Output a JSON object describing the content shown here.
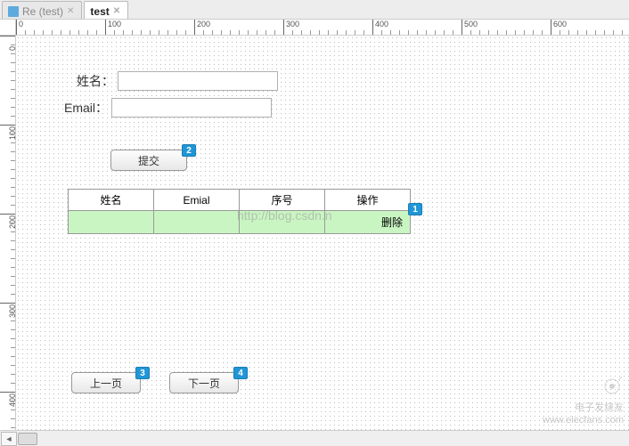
{
  "tabs": [
    {
      "label": "Re (test)",
      "active": false,
      "has_icon": true
    },
    {
      "label": "test",
      "active": true,
      "has_icon": false
    }
  ],
  "ruler_ticks": [
    0,
    100,
    200,
    300,
    400,
    500,
    600
  ],
  "ruler_ticks_v": [
    0,
    100,
    200,
    300,
    400
  ],
  "form": {
    "name_label": "姓名：",
    "email_label": "Email：",
    "name_value": "",
    "email_value": ""
  },
  "buttons": {
    "submit": "提交",
    "prev": "上一页",
    "next": "下一页"
  },
  "table": {
    "headers": [
      "姓名",
      "Emial",
      "序号",
      "操作"
    ],
    "row": {
      "name": "",
      "email": "",
      "seq": "",
      "action": "删除"
    }
  },
  "badges": {
    "b1": "1",
    "b2": "2",
    "b3": "3",
    "b4": "4"
  },
  "watermark_center": "http://blog.csdn.n",
  "watermark_source_line1": "电子发烧友",
  "watermark_source_line2": "www.elecfans.com",
  "chart_data": {
    "type": "table",
    "headers": [
      "姓名",
      "Emial",
      "序号",
      "操作"
    ],
    "rows": [
      {
        "姓名": "",
        "Emial": "",
        "序号": "",
        "操作": "删除"
      }
    ]
  }
}
